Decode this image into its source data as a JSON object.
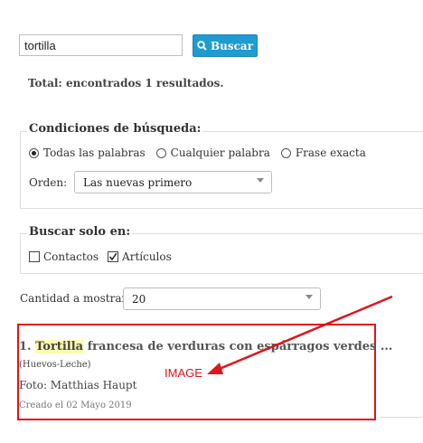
{
  "search": {
    "query": "tortilla",
    "button_label": "Buscar"
  },
  "total_text": "Total: encontrados 1 resultados.",
  "conditions": {
    "legend": "Condiciones de búsqueda:",
    "options": [
      "Todas las palabras",
      "Cualquier palabra",
      "Frase exacta"
    ],
    "selected_index": 0,
    "order_label": "Orden:",
    "order_value": "Las nuevas primero"
  },
  "search_in": {
    "legend": "Buscar solo en:",
    "options": [
      {
        "label": "Contactos",
        "checked": false
      },
      {
        "label": "Artículos",
        "checked": true
      }
    ]
  },
  "quantity": {
    "label": "Cantidad a mostrar",
    "value": "20"
  },
  "result": {
    "number": "1.",
    "highlight": "Tortilla",
    "title_rest": "francesa de verduras con espárragos verdes ...",
    "category": "(Huevos-Leche)",
    "credit": "Foto: Matthias Haupt",
    "date": "Creado el 02 Mayo 2019"
  },
  "annotation": {
    "label": "IMAGE",
    "color": "#e0141a"
  },
  "colors": {
    "button": "#1f9bd2",
    "highlight": "#fffbb0"
  }
}
